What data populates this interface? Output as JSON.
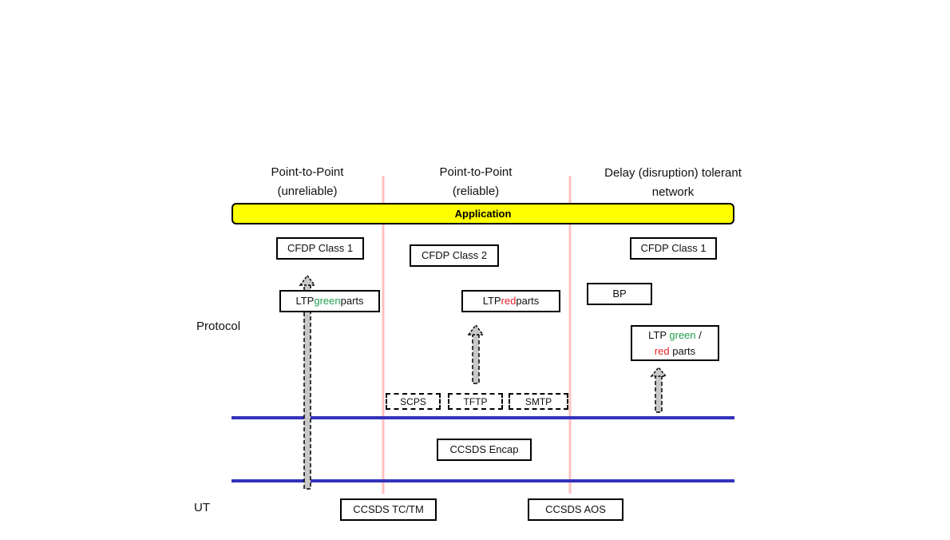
{
  "columns": [
    {
      "line1": "Point-to-Point",
      "line2": "(unreliable)"
    },
    {
      "line1": "Point-to-Point",
      "line2": "(reliable)"
    },
    {
      "line1": "Delay (disruption) tolerant",
      "line2": "network"
    }
  ],
  "application": "Application",
  "layers": {
    "protocol": "Protocol",
    "ut": "UT"
  },
  "boxes": {
    "cfdp1_left": "CFDP Class 1",
    "cfdp2": "CFDP Class 2",
    "cfdp1_right": "CFDP Class 1",
    "bp": "BP",
    "ltp_green": {
      "a": "LTP ",
      "b": "green",
      "c": " parts"
    },
    "ltp_red": {
      "a": "LTP ",
      "b": "red",
      "c": " parts"
    },
    "ltp_both": {
      "a": "LTP ",
      "b": "green",
      "c": " /",
      "d": "red",
      "e": " parts"
    },
    "scps": "SCPS",
    "tftp": "TFTP",
    "smtp": "SMTP",
    "encap": "CCSDS Encap",
    "tctm": "CCSDS TC/TM",
    "aos": "CCSDS AOS"
  },
  "colors": {
    "application": "#ffff00",
    "layer_line": "#3333bb",
    "column_divider": "#ffc0c0",
    "green": "#22a050",
    "red": "#e8202a"
  }
}
